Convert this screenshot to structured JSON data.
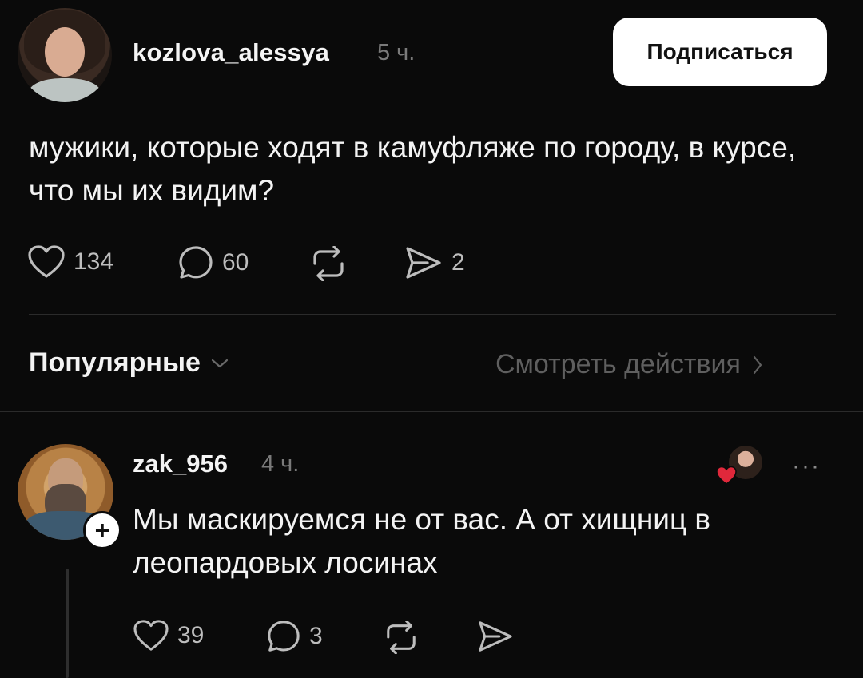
{
  "post": {
    "username": "kozlova_alessya",
    "time": "5 ч.",
    "follow_label": "Подписаться",
    "text": "мужики, которые ходят в камуфляже по городу, в курсе, что мы их видим?",
    "likes": "134",
    "comments": "60",
    "shares": "2"
  },
  "sort": {
    "label": "Популярные",
    "activity_label": "Смотреть действия"
  },
  "reply": {
    "username": "zak_956",
    "time": "4 ч.",
    "text": "Мы маскируемся не от вас. А от хищниц в леопардовых лосинах",
    "likes": "39",
    "comments": "3",
    "more": "···"
  },
  "icons": [
    "heart-icon",
    "comment-icon",
    "repost-icon",
    "send-icon",
    "chevron-down-icon",
    "chevron-right-icon",
    "plus-icon"
  ],
  "colors": {
    "background": "#0a0a0a",
    "text": "#f3f3f3",
    "muted": "#7a7a7a",
    "button_bg": "#ffffff",
    "like_heart": "#e0283b"
  }
}
